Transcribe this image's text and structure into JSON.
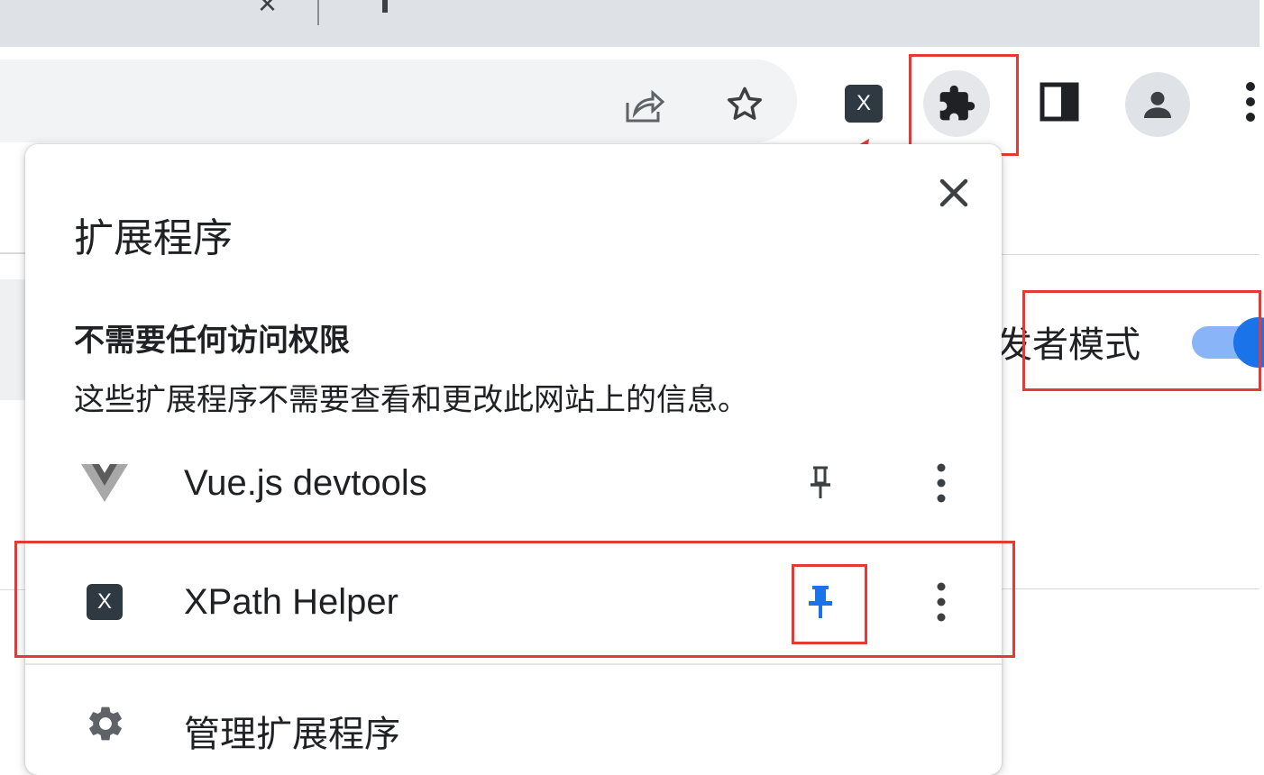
{
  "browser": {
    "tab_close_glyph": "×",
    "toolbar_icons": [
      "share-icon",
      "bookmark-star-icon",
      "xpath-helper-extension-icon",
      "extensions-puzzle-icon",
      "side-panel-icon",
      "profile-avatar-icon",
      "more-menu-icon"
    ],
    "xpath_toolbar_glyph": "X"
  },
  "background_page": {
    "developer_mode_label": "发者模式",
    "developer_mode_on": true,
    "toggle_color": "#1a73e8"
  },
  "popup": {
    "title": "扩展程序",
    "close_glyph": "×",
    "section_title": "不需要任何访问权限",
    "section_description": "这些扩展程序不需要查看和更改此网站上的信息。",
    "extensions": [
      {
        "name": "Vue.js devtools",
        "icon": "vue-logo-icon",
        "pinned": false
      },
      {
        "name": "XPath Helper",
        "icon": "xpath-helper-icon",
        "icon_glyph": "X",
        "pinned": true
      }
    ],
    "manage_label": "管理扩展程序",
    "pin_color_active": "#1a73e8"
  },
  "annotations": {
    "highlight_color": "#e53935"
  }
}
